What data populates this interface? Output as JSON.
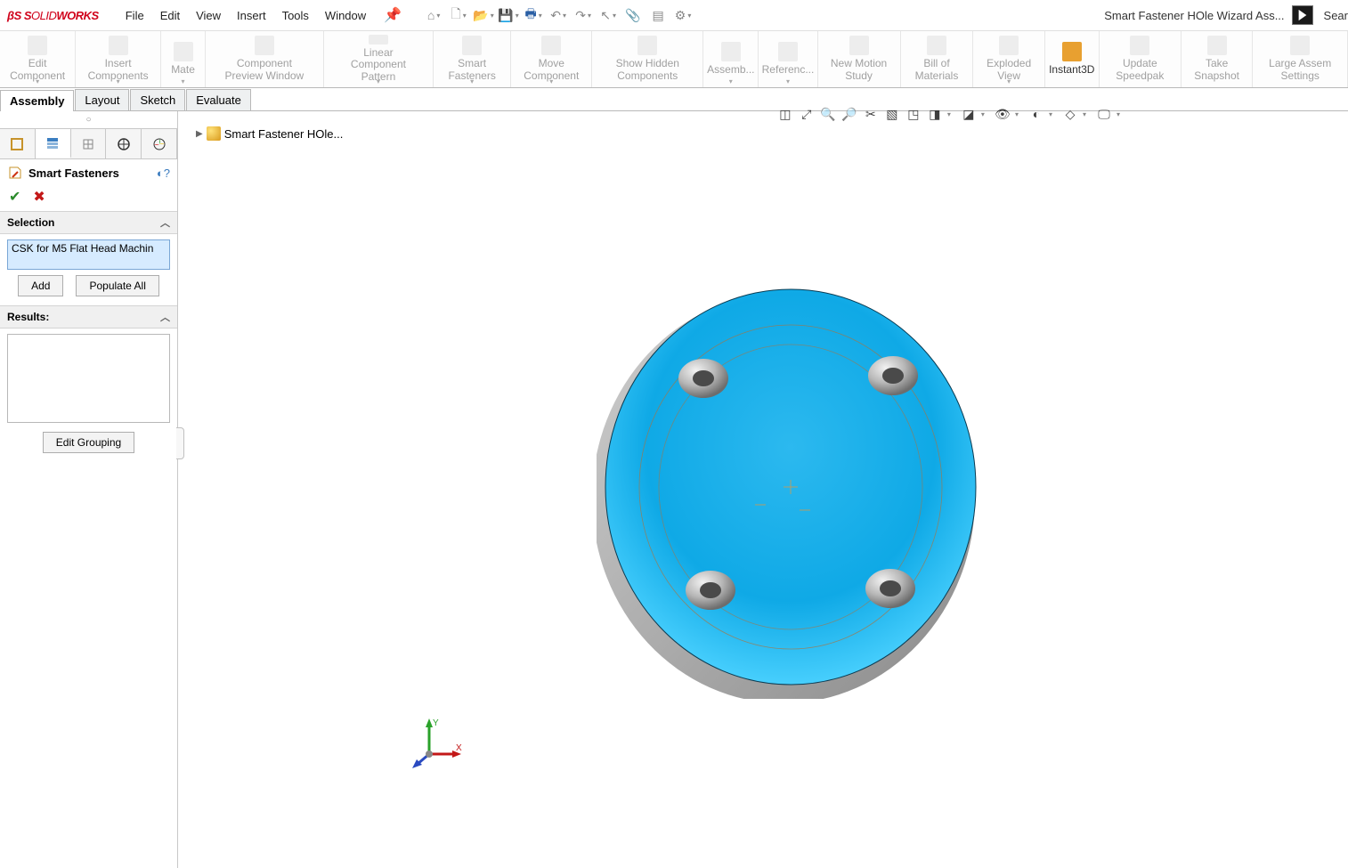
{
  "app": {
    "name": "SOLIDWORKS",
    "doc_title": "Smart Fastener HOle Wizard Ass...",
    "search_label": "Sear"
  },
  "menu": [
    "File",
    "Edit",
    "View",
    "Insert",
    "Tools",
    "Window"
  ],
  "ribbon": [
    {
      "label": "Edit Component"
    },
    {
      "label": "Insert Components"
    },
    {
      "label": "Mate"
    },
    {
      "label": "Component Preview Window"
    },
    {
      "label": "Linear Component Pattern"
    },
    {
      "label": "Smart Fasteners"
    },
    {
      "label": "Move Component"
    },
    {
      "label": "Show Hidden Components"
    },
    {
      "label": "Assemb..."
    },
    {
      "label": "Referenc..."
    },
    {
      "label": "New Motion Study"
    },
    {
      "label": "Bill of Materials"
    },
    {
      "label": "Exploded View"
    },
    {
      "label": "Instant3D",
      "active": true
    },
    {
      "label": "Update Speedpak"
    },
    {
      "label": "Take Snapshot"
    },
    {
      "label": "Large Assem Settings"
    }
  ],
  "cmdtabs": [
    {
      "label": "Assembly",
      "active": true
    },
    {
      "label": "Layout"
    },
    {
      "label": "Sketch"
    },
    {
      "label": "Evaluate"
    }
  ],
  "breadcrumb": "Smart Fastener HOle...",
  "pm": {
    "title": "Smart Fasteners",
    "sections": {
      "selection": {
        "title": "Selection",
        "items": [
          "CSK for M5 Flat Head Machin"
        ]
      },
      "results": {
        "title": "Results:"
      }
    },
    "buttons": {
      "add": "Add",
      "populate": "Populate All",
      "edit_grouping": "Edit Grouping"
    }
  }
}
